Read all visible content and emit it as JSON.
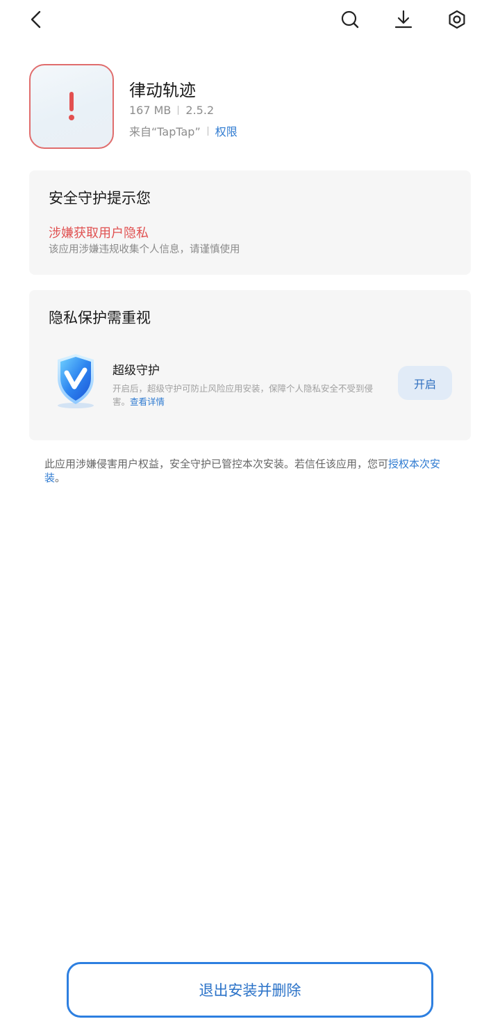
{
  "icons": {
    "back": "back-arrow-icon",
    "search": "search-icon",
    "download": "download-icon",
    "settings": "settings-hexagon-icon",
    "warning": "exclamation-warning-icon",
    "shield": "shield-v-icon"
  },
  "colors": {
    "accent_blue": "#2f7bd1",
    "danger_red": "#e05252",
    "icon_border_red": "#e06c6c",
    "card_bg": "#f6f6f6",
    "button_border": "#2d7fe0"
  },
  "app": {
    "name": "律动轨迹",
    "size": "167 MB",
    "version": "2.5.2",
    "source": "来自“TapTap”",
    "permissions_link": "权限"
  },
  "security_card": {
    "title": "安全守护提示您",
    "risk_title": "涉嫌获取用户隐私",
    "risk_desc": "该应用涉嫌违规收集个人信息，请谨慎使用"
  },
  "privacy_card": {
    "title": "隐私保护需重视",
    "guard_title": "超级守护",
    "guard_desc": "开启后，超级守护可防止风险应用安装，保障个人隐私安全不受到侵害。",
    "guard_link": "查看详情",
    "enable_button": "开启"
  },
  "notice": {
    "text": "此应用涉嫌侵害用户权益，安全守护已管控本次安装。若信任该应用，您可",
    "link": "授权本次安装",
    "suffix": "。"
  },
  "bottom_button": "退出安装并删除"
}
